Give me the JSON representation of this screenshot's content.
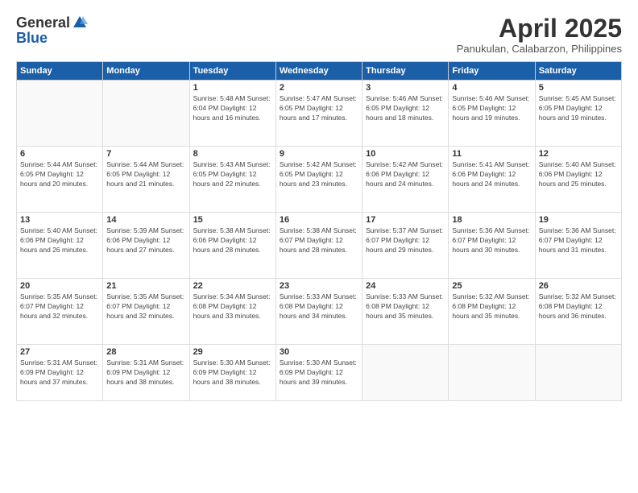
{
  "header": {
    "logo_general": "General",
    "logo_blue": "Blue",
    "month_title": "April 2025",
    "subtitle": "Panukulan, Calabarzon, Philippines"
  },
  "days_of_week": [
    "Sunday",
    "Monday",
    "Tuesday",
    "Wednesday",
    "Thursday",
    "Friday",
    "Saturday"
  ],
  "weeks": [
    [
      {
        "day": "",
        "info": ""
      },
      {
        "day": "",
        "info": ""
      },
      {
        "day": "1",
        "info": "Sunrise: 5:48 AM\nSunset: 6:04 PM\nDaylight: 12 hours and 16 minutes."
      },
      {
        "day": "2",
        "info": "Sunrise: 5:47 AM\nSunset: 6:05 PM\nDaylight: 12 hours and 17 minutes."
      },
      {
        "day": "3",
        "info": "Sunrise: 5:46 AM\nSunset: 6:05 PM\nDaylight: 12 hours and 18 minutes."
      },
      {
        "day": "4",
        "info": "Sunrise: 5:46 AM\nSunset: 6:05 PM\nDaylight: 12 hours and 19 minutes."
      },
      {
        "day": "5",
        "info": "Sunrise: 5:45 AM\nSunset: 6:05 PM\nDaylight: 12 hours and 19 minutes."
      }
    ],
    [
      {
        "day": "6",
        "info": "Sunrise: 5:44 AM\nSunset: 6:05 PM\nDaylight: 12 hours and 20 minutes."
      },
      {
        "day": "7",
        "info": "Sunrise: 5:44 AM\nSunset: 6:05 PM\nDaylight: 12 hours and 21 minutes."
      },
      {
        "day": "8",
        "info": "Sunrise: 5:43 AM\nSunset: 6:05 PM\nDaylight: 12 hours and 22 minutes."
      },
      {
        "day": "9",
        "info": "Sunrise: 5:42 AM\nSunset: 6:05 PM\nDaylight: 12 hours and 23 minutes."
      },
      {
        "day": "10",
        "info": "Sunrise: 5:42 AM\nSunset: 6:06 PM\nDaylight: 12 hours and 24 minutes."
      },
      {
        "day": "11",
        "info": "Sunrise: 5:41 AM\nSunset: 6:06 PM\nDaylight: 12 hours and 24 minutes."
      },
      {
        "day": "12",
        "info": "Sunrise: 5:40 AM\nSunset: 6:06 PM\nDaylight: 12 hours and 25 minutes."
      }
    ],
    [
      {
        "day": "13",
        "info": "Sunrise: 5:40 AM\nSunset: 6:06 PM\nDaylight: 12 hours and 26 minutes."
      },
      {
        "day": "14",
        "info": "Sunrise: 5:39 AM\nSunset: 6:06 PM\nDaylight: 12 hours and 27 minutes."
      },
      {
        "day": "15",
        "info": "Sunrise: 5:38 AM\nSunset: 6:06 PM\nDaylight: 12 hours and 28 minutes."
      },
      {
        "day": "16",
        "info": "Sunrise: 5:38 AM\nSunset: 6:07 PM\nDaylight: 12 hours and 28 minutes."
      },
      {
        "day": "17",
        "info": "Sunrise: 5:37 AM\nSunset: 6:07 PM\nDaylight: 12 hours and 29 minutes."
      },
      {
        "day": "18",
        "info": "Sunrise: 5:36 AM\nSunset: 6:07 PM\nDaylight: 12 hours and 30 minutes."
      },
      {
        "day": "19",
        "info": "Sunrise: 5:36 AM\nSunset: 6:07 PM\nDaylight: 12 hours and 31 minutes."
      }
    ],
    [
      {
        "day": "20",
        "info": "Sunrise: 5:35 AM\nSunset: 6:07 PM\nDaylight: 12 hours and 32 minutes."
      },
      {
        "day": "21",
        "info": "Sunrise: 5:35 AM\nSunset: 6:07 PM\nDaylight: 12 hours and 32 minutes."
      },
      {
        "day": "22",
        "info": "Sunrise: 5:34 AM\nSunset: 6:08 PM\nDaylight: 12 hours and 33 minutes."
      },
      {
        "day": "23",
        "info": "Sunrise: 5:33 AM\nSunset: 6:08 PM\nDaylight: 12 hours and 34 minutes."
      },
      {
        "day": "24",
        "info": "Sunrise: 5:33 AM\nSunset: 6:08 PM\nDaylight: 12 hours and 35 minutes."
      },
      {
        "day": "25",
        "info": "Sunrise: 5:32 AM\nSunset: 6:08 PM\nDaylight: 12 hours and 35 minutes."
      },
      {
        "day": "26",
        "info": "Sunrise: 5:32 AM\nSunset: 6:08 PM\nDaylight: 12 hours and 36 minutes."
      }
    ],
    [
      {
        "day": "27",
        "info": "Sunrise: 5:31 AM\nSunset: 6:09 PM\nDaylight: 12 hours and 37 minutes."
      },
      {
        "day": "28",
        "info": "Sunrise: 5:31 AM\nSunset: 6:09 PM\nDaylight: 12 hours and 38 minutes."
      },
      {
        "day": "29",
        "info": "Sunrise: 5:30 AM\nSunset: 6:09 PM\nDaylight: 12 hours and 38 minutes."
      },
      {
        "day": "30",
        "info": "Sunrise: 5:30 AM\nSunset: 6:09 PM\nDaylight: 12 hours and 39 minutes."
      },
      {
        "day": "",
        "info": ""
      },
      {
        "day": "",
        "info": ""
      },
      {
        "day": "",
        "info": ""
      }
    ]
  ]
}
